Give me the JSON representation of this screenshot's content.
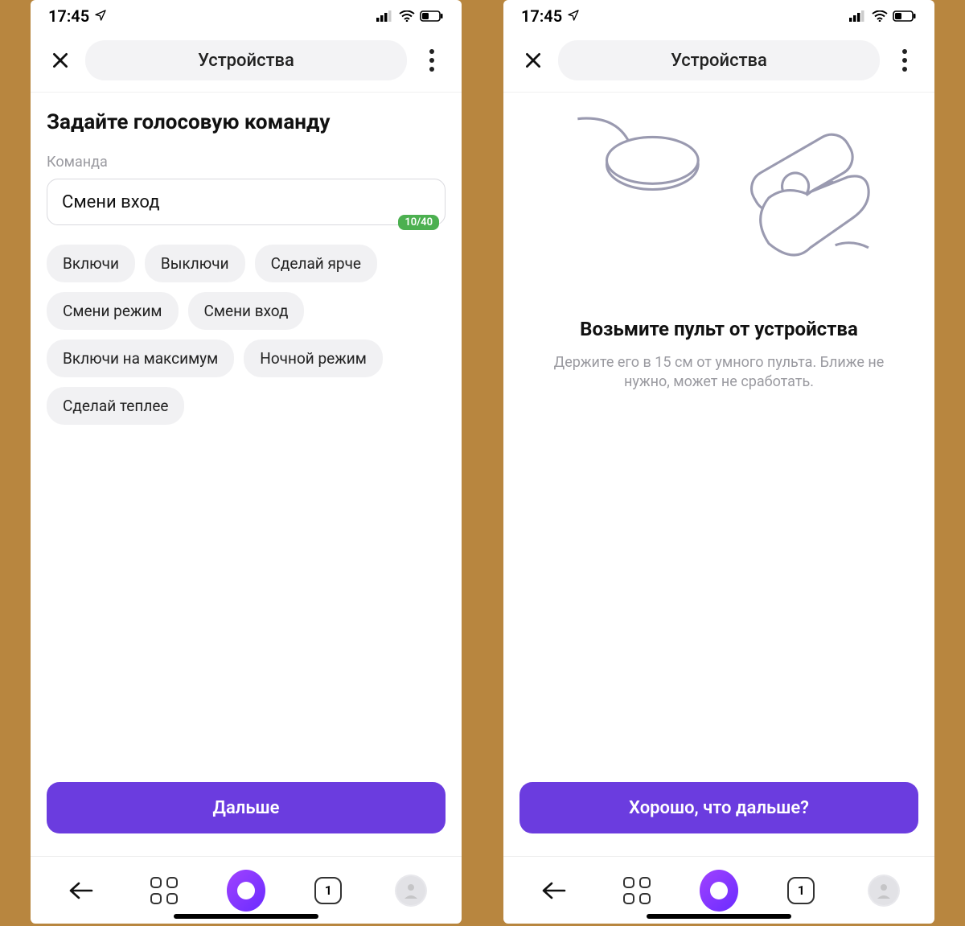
{
  "statusbar": {
    "time": "17:45"
  },
  "header": {
    "title": "Устройства"
  },
  "screen1": {
    "title": "Задайте голосовую команду",
    "field_label": "Команда",
    "field_value": "Смени вход",
    "counter": "10/40",
    "chips": [
      "Включи",
      "Выключи",
      "Сделай ярче",
      "Смени режим",
      "Смени вход",
      "Включи на максимум",
      "Ночной режим",
      "Сделай теплее"
    ],
    "primary": "Дальше"
  },
  "screen2": {
    "heading": "Возьмите пульт от устройства",
    "sub": "Держите его в 15 см от умного пульта. Ближе не нужно, может не сработать.",
    "primary": "Хорошо, что дальше?"
  },
  "bottomnav": {
    "tabcount": "1"
  }
}
